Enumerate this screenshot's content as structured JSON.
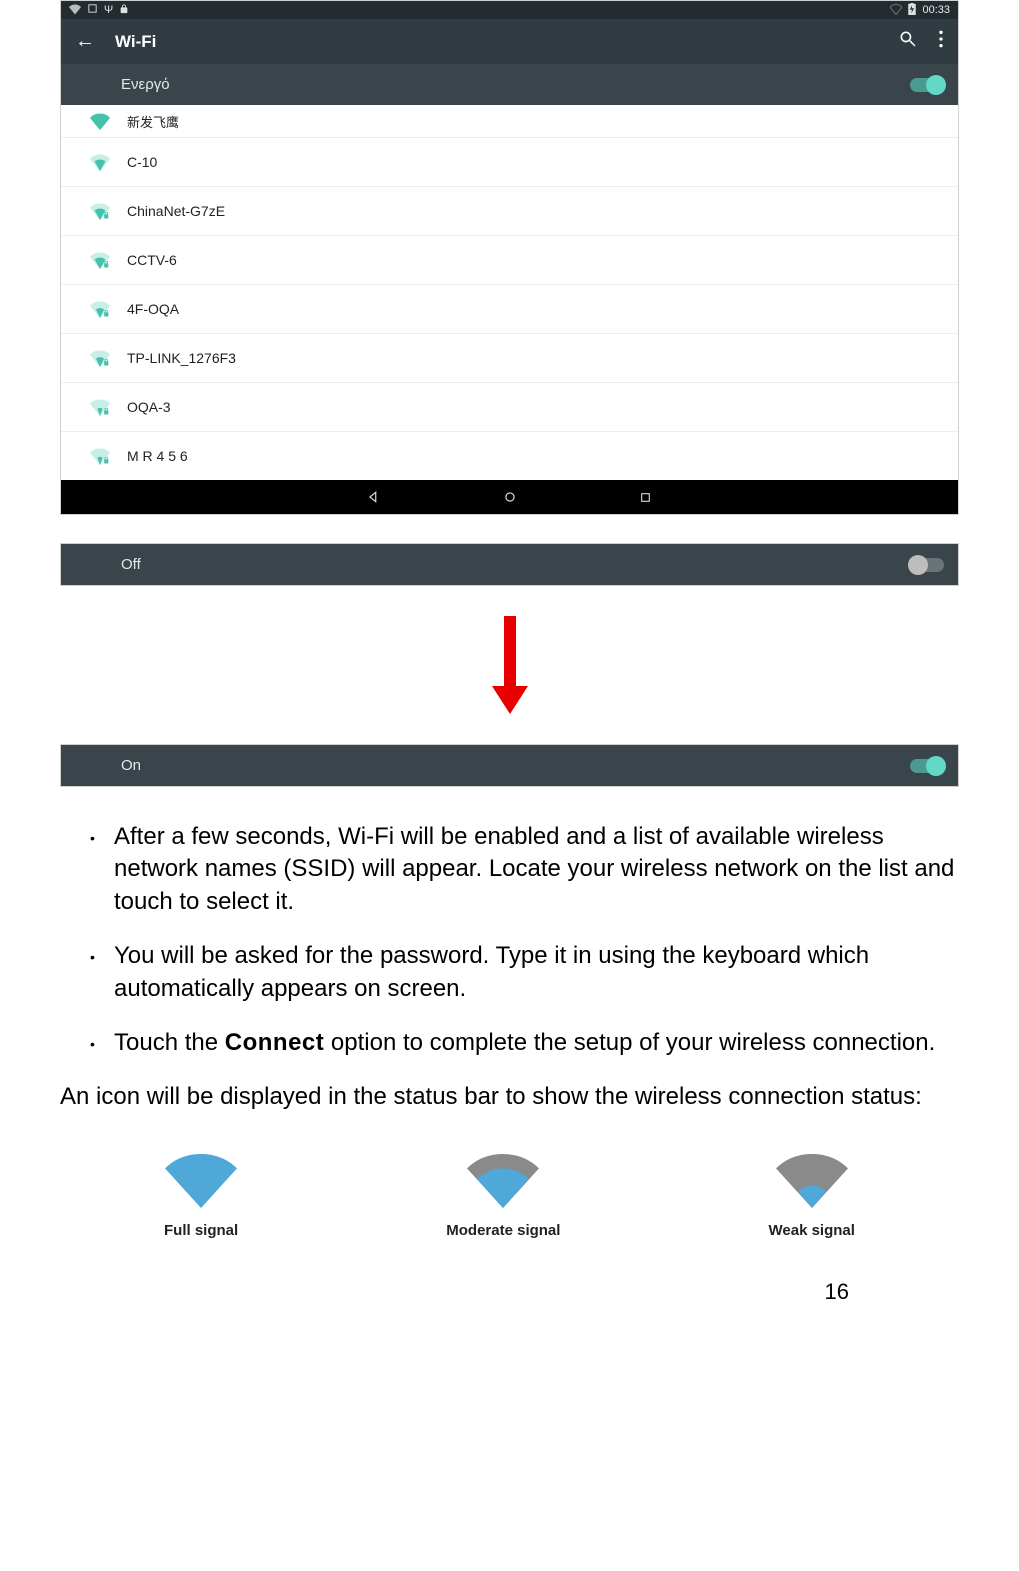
{
  "status_bar": {
    "time": "00:33"
  },
  "app_bar": {
    "title": "Wi-Fi"
  },
  "toggle": {
    "label": "Ενεργό"
  },
  "networks": [
    {
      "ssid": "新发飞鹰"
    },
    {
      "ssid": "C-10"
    },
    {
      "ssid": "ChinaNet-G7zE"
    },
    {
      "ssid": "CCTV-6"
    },
    {
      "ssid": "4F-OQA"
    },
    {
      "ssid": "TP-LINK_1276F3"
    },
    {
      "ssid": "OQA-3"
    },
    {
      "ssid": "M R 4 5 6"
    }
  ],
  "state_off": {
    "label": "Off"
  },
  "state_on": {
    "label": "On"
  },
  "bullets": {
    "b1": "After a few seconds, Wi-Fi will be enabled and a list of available wireless network names (SSID) will appear. Locate your wireless network on the list and touch to select it.",
    "b2": "You will be asked for the password. Type it in using the keyboard which automatically appears on screen.",
    "b3a": "Touch the ",
    "b3bold": "Connect",
    "b3b": " option to complete the setup of your wireless connection."
  },
  "paragraph": "An icon will be displayed in the status bar to show the wireless connection status:",
  "signals": {
    "full": "Full signal",
    "moderate": "Moderate signal",
    "weak": "Weak signal"
  },
  "page_number": "16"
}
